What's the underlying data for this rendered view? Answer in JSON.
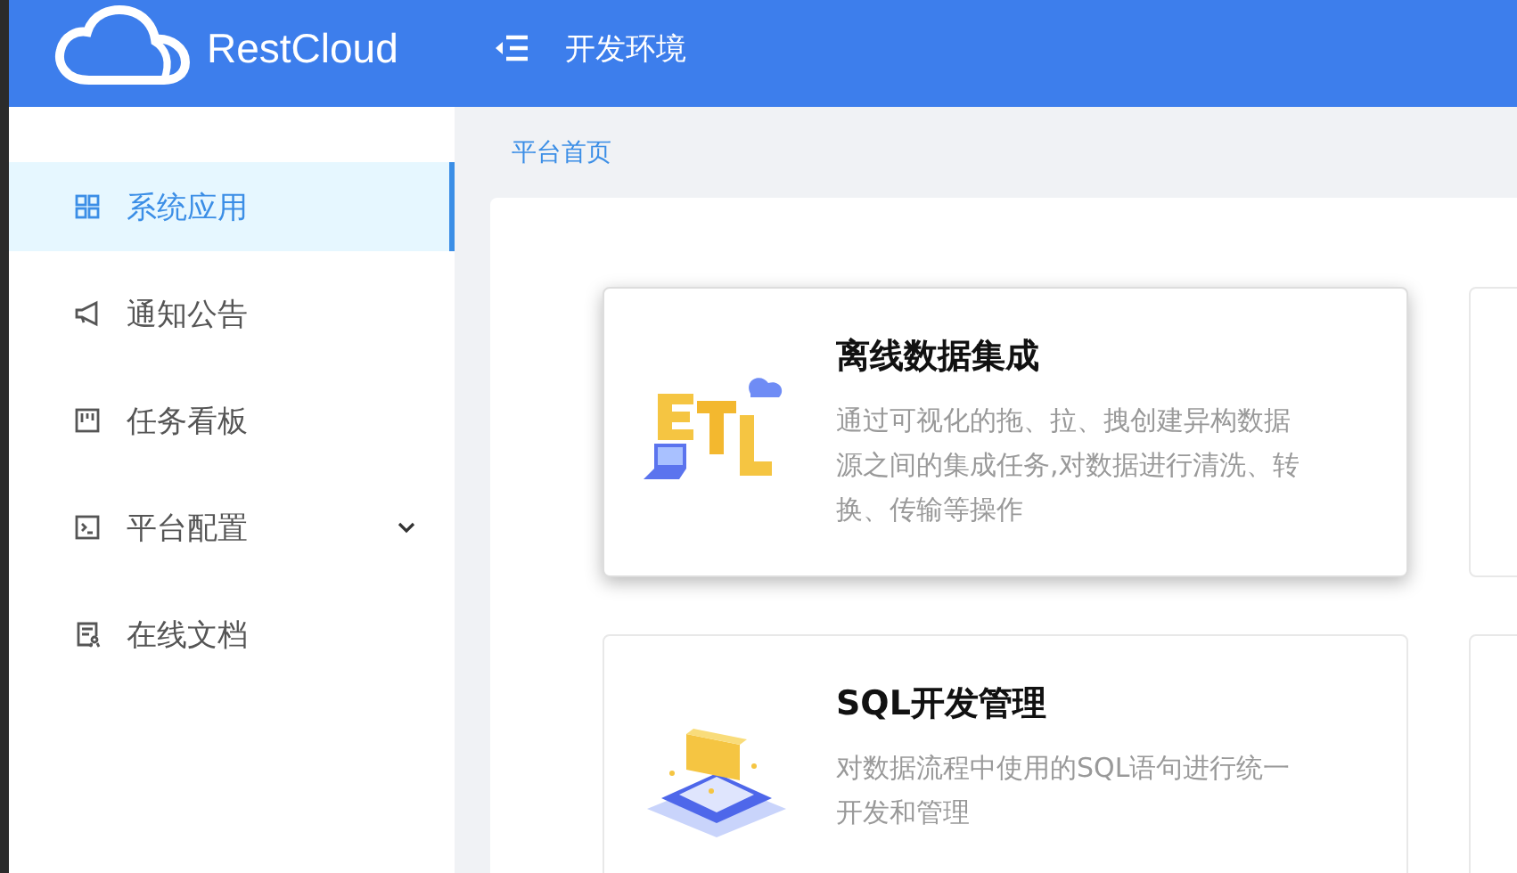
{
  "header": {
    "brand": "RestCloud",
    "title": "开发环境"
  },
  "sidebar": {
    "items": [
      {
        "label": "系统应用",
        "kind": "link",
        "selected": true
      },
      {
        "label": "通知公告",
        "kind": "link",
        "selected": false
      },
      {
        "label": "任务看板",
        "kind": "link",
        "selected": false
      },
      {
        "label": "平台配置",
        "kind": "group",
        "selected": false,
        "expanded": false
      },
      {
        "label": "在线文档",
        "kind": "link",
        "selected": false
      }
    ]
  },
  "breadcrumb": [
    "平台首页"
  ],
  "cards": [
    {
      "kind": "etl",
      "title": "离线数据集成",
      "description": "通过可视化的拖、拉、拽创建异构数据源之间的集成任务,对数据进行清洗、转换、传输等操作",
      "hovered": true
    },
    {
      "kind": "sql",
      "title": "SQL开发管理",
      "description": "对数据流程中使用的SQL语句进行统一开发和管理",
      "hovered": false
    }
  ]
}
